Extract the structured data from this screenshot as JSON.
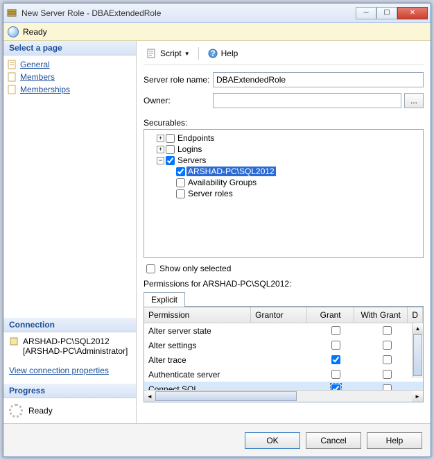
{
  "titlebar": {
    "title": "New Server Role - DBAExtendedRole"
  },
  "ready_banner": {
    "text": "Ready"
  },
  "pages": {
    "header": "Select a page",
    "items": [
      {
        "label": "General"
      },
      {
        "label": "Members"
      },
      {
        "label": "Memberships"
      }
    ]
  },
  "connection": {
    "header": "Connection",
    "server": "ARSHAD-PC\\SQL2012",
    "user": "[ARSHAD-PC\\Administrator]",
    "link": "View connection properties"
  },
  "progress": {
    "header": "Progress",
    "status": "Ready"
  },
  "toolbar": {
    "script_label": "Script",
    "help_label": "Help"
  },
  "form": {
    "role_name_label": "Server role name:",
    "role_name_value": "DBAExtendedRole",
    "owner_label": "Owner:",
    "owner_value": "",
    "securables_label": "Securables:"
  },
  "tree": {
    "nodes": [
      {
        "label": "Endpoints",
        "expanded": false,
        "checked": false,
        "level": 1
      },
      {
        "label": "Logins",
        "expanded": false,
        "checked": false,
        "level": 1
      },
      {
        "label": "Servers",
        "expanded": true,
        "checked": true,
        "level": 1
      },
      {
        "label": "ARSHAD-PC\\SQL2012",
        "checked": true,
        "level": 2,
        "selected": true
      },
      {
        "label": "Availability Groups",
        "checked": false,
        "level": 2
      },
      {
        "label": "Server roles",
        "checked": false,
        "level": 2
      }
    ]
  },
  "show_only_label": "Show only selected",
  "permissions": {
    "label": "Permissions for ARSHAD-PC\\SQL2012:",
    "tab": "Explicit",
    "columns": {
      "perm": "Permission",
      "grantor": "Grantor",
      "grant": "Grant",
      "withgrant": "With Grant",
      "deny": "D"
    },
    "rows": [
      {
        "perm": "Alter server state",
        "grantor": "",
        "grant": false,
        "withgrant": false
      },
      {
        "perm": "Alter settings",
        "grantor": "",
        "grant": false,
        "withgrant": false
      },
      {
        "perm": "Alter trace",
        "grantor": "",
        "grant": true,
        "withgrant": false
      },
      {
        "perm": "Authenticate server",
        "grantor": "",
        "grant": false,
        "withgrant": false
      },
      {
        "perm": "Connect SQL",
        "grantor": "",
        "grant": true,
        "withgrant": false,
        "selected": true
      }
    ]
  },
  "footer": {
    "ok": "OK",
    "cancel": "Cancel",
    "help": "Help"
  }
}
